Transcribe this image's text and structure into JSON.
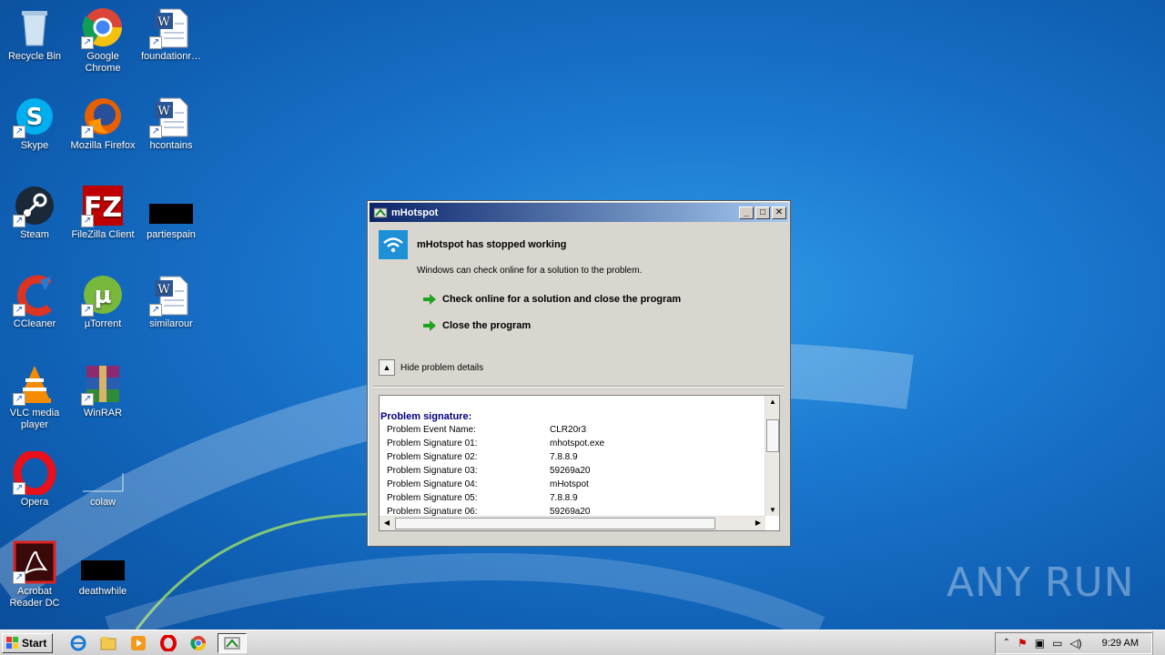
{
  "desktop": {
    "icons": [
      {
        "label": "Recycle Bin",
        "icon": "recycle-bin-icon"
      },
      {
        "label": "Google Chrome",
        "icon": "chrome-icon"
      },
      {
        "label": "foundationr…",
        "icon": "word-doc-icon"
      },
      {
        "label": "Skype",
        "icon": "skype-icon"
      },
      {
        "label": "Mozilla Firefox",
        "icon": "firefox-icon"
      },
      {
        "label": "hcontains",
        "icon": "word-doc-icon"
      },
      {
        "label": "Steam",
        "icon": "steam-icon"
      },
      {
        "label": "FileZilla Client",
        "icon": "filezilla-icon"
      },
      {
        "label": "partiespain",
        "icon": "black-file-icon"
      },
      {
        "label": "CCleaner",
        "icon": "ccleaner-icon"
      },
      {
        "label": "µTorrent",
        "icon": "utorrent-icon"
      },
      {
        "label": "similarour",
        "icon": "word-doc-icon"
      },
      {
        "label": "VLC media player",
        "icon": "vlc-icon"
      },
      {
        "label": "WinRAR",
        "icon": "winrar-icon"
      },
      {
        "label": "Opera",
        "icon": "opera-icon"
      },
      {
        "label": "colaw",
        "icon": "blank-file-icon"
      },
      {
        "label": "Acrobat Reader DC",
        "icon": "acrobat-icon"
      },
      {
        "label": "deathwhile",
        "icon": "black-file-icon"
      }
    ]
  },
  "dialog": {
    "window_title": "mHotspot",
    "heading": "mHotspot has stopped working",
    "subtext": "Windows can check online for a solution to the problem.",
    "option_check_online": "Check online for a solution and close the program",
    "option_close": "Close the program",
    "toggle_details": "Hide problem details",
    "details_header": "Problem signature:",
    "details_rows": [
      {
        "key": "Problem Event Name:",
        "value": "CLR20r3"
      },
      {
        "key": "Problem Signature 01:",
        "value": "mhotspot.exe"
      },
      {
        "key": "Problem Signature 02:",
        "value": "7.8.8.9"
      },
      {
        "key": "Problem Signature 03:",
        "value": "59269a20"
      },
      {
        "key": "Problem Signature 04:",
        "value": "mHotspot"
      },
      {
        "key": "Problem Signature 05:",
        "value": "7.8.8.9"
      },
      {
        "key": "Problem Signature 06:",
        "value": "59269a20"
      }
    ]
  },
  "taskbar": {
    "start_label": "Start",
    "clock": "9:29 AM"
  },
  "watermark": "ANY RUN",
  "colors": {
    "title_gradient_start": "#0a246a",
    "title_gradient_end": "#a6caf0",
    "desktop_blue": "#1b78cf"
  }
}
